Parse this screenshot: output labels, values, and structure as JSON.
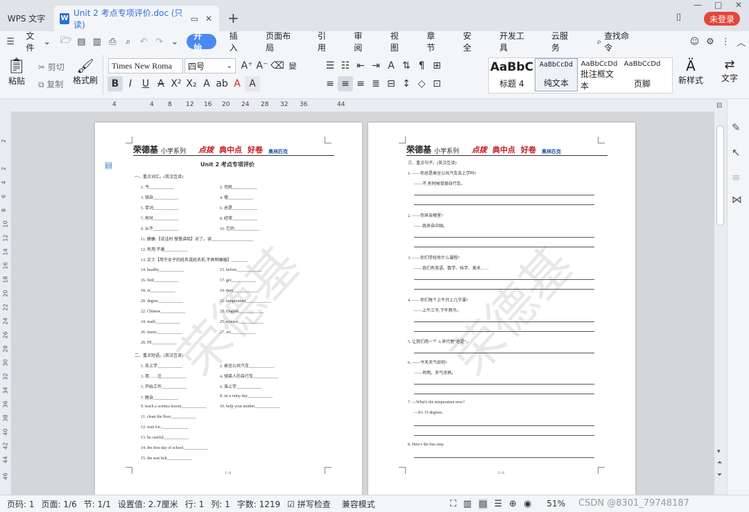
{
  "window": {
    "app_tab": "WPS 文字",
    "doc_tab_title": "Unit 2 考点专项评价.doc (只读)",
    "login_button": "未登录"
  },
  "menu": {
    "file": "文件",
    "tabs": [
      "开始",
      "插入",
      "页面布局",
      "引用",
      "审阅",
      "视图",
      "章节",
      "安全",
      "开发工具",
      "云服务"
    ],
    "search": "查找命令"
  },
  "ribbon": {
    "paste": "粘贴",
    "cut": "剪切",
    "copy": "复制",
    "format_painter": "格式刷",
    "font_name": "Times New Roma",
    "font_size": "四号",
    "styles": [
      {
        "preview": "AaBbC",
        "label": "标题 4"
      },
      {
        "preview": "AaBbCcDd",
        "label": "纯文本"
      },
      {
        "preview": "AaBbCcDd",
        "label": "批注框文本"
      },
      {
        "preview": "AaBbCcDd",
        "label": "页脚"
      }
    ],
    "new_style": "新样式",
    "text_tool": "文字"
  },
  "ruler": {
    "h": [
      "4",
      "4",
      "8",
      "12",
      "16",
      "20",
      "24",
      "28",
      "32",
      "36",
      "44"
    ],
    "v": [
      "2",
      "2",
      "4",
      "6",
      "8",
      "10",
      "12",
      "14",
      "16",
      "18",
      "20",
      "22",
      "24",
      "26",
      "28",
      "30",
      "32",
      "34",
      "36",
      "38",
      "40",
      "42",
      "44",
      "46"
    ]
  },
  "page1": {
    "brand_name": "荣德基",
    "series": "小学系列",
    "brand_tags": [
      "点拨",
      "典中点",
      "好卷",
      "奥林匹克"
    ],
    "title": "Unit 2  考点专项评价",
    "section1": "一、重点词汇。(英汉互译)",
    "lines": [
      "1. 今____________",
      "2. 司机____________",
      "3. 骑自____________",
      "4. 慢____________",
      "5. 单词____________",
      "6. 总是____________",
      "7. 有时____________",
      "8. 经常____________",
      "9. 从不____________",
      "10. 它的____________",
      "11. 健康:【说话时 慢慢讲吸】对了。读____________________",
      "12. 有用:不着___________",
      "13. 文士【用于女子的姓名或姓名前,不再明确婚】________",
      "14. healthy____________",
      "15. before____________",
      "16. find____________",
      "17. get____________",
      "18. or____________",
      "19. very____________",
      "20. degree____________",
      "21. temperature____________",
      "22. Chinese____________",
      "23. English____________",
      "24. math____________",
      "25. science____________",
      "26. music____________",
      "27. art____________",
      "28. PE____________"
    ],
    "section2": "二、重点短语。(英汉互译)",
    "lines2": [
      "1. 去上学____________",
      "2. 乘坐公共汽车____________",
      "3. 用……注____________",
      "4. 骑某人的自行车____________",
      "5. 开始工作____________",
      "6. 准上学____________",
      "7. 晚自____________",
      "8. on a rainy day____________",
      "9. teach a science lesson____________",
      "10. help your mother____________",
      "11. clean the floor____________",
      "12. wait for...____________",
      "13. be careful____________",
      "14. the first day of school____________",
      "15. the seat belt____________"
    ],
    "page_num": "1 / 6",
    "watermark": "荣德基"
  },
  "page2": {
    "brand_name": "荣德基",
    "series": "小学系列",
    "brand_tags": [
      "点拨",
      "典中点",
      "好卷",
      "奥林匹克"
    ],
    "section3": "三、重点句子。(英汉互译)",
    "items": [
      {
        "q": "1. ——你总是乘坐公共汽车去上学吗?",
        "a": "——不,有时候我骑自行车。"
      },
      {
        "q": "2. ——你来自哪里?",
        "a": "——我来自中国。"
      },
      {
        "q": "3. ——你们学校有什么课程?",
        "a": "——我们有英语、数学、科学、美术……"
      },
      {
        "q": "4. ——你们每个上午只上几节课?",
        "a": "——上午三节,下午两节。"
      },
      {
        "q": "5. 让我们用一个 A 来代替“总是”。",
        "a": ""
      },
      {
        "q": "6. ——今天天气如何?",
        "a": "——有雨。天气凉爽。"
      },
      {
        "q": "7. —What's the temperature now?",
        "a": "—It's 15 degrees."
      },
      {
        "q": "8. Here's the bus stop.",
        "a": ""
      }
    ],
    "page_num": "2 / 6",
    "watermark": "荣德基"
  },
  "status": {
    "page_no": "页码: 1",
    "pages": "页面: 1/6",
    "section": "节: 1/1",
    "setting": "设置值: 2.7厘米",
    "row": "行: 1",
    "col": "列: 1",
    "words": "字数: 1219",
    "spell": "拼写检查",
    "compat": "兼容模式",
    "zoom": "51%",
    "watermark_text": "CSDN @8301_79748187"
  }
}
